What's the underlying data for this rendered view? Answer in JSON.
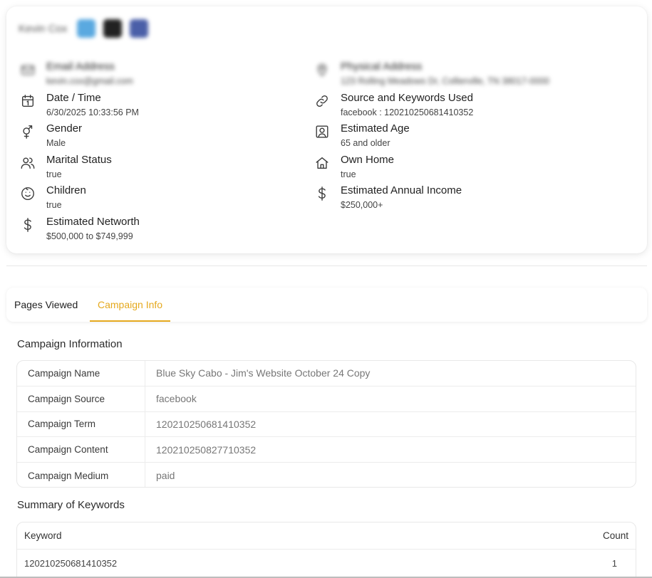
{
  "profile": {
    "name": "Kevin Cox",
    "social_colors": [
      "#5aa9e0",
      "#222222",
      "#4a5fa8"
    ]
  },
  "fields_left": [
    {
      "icon": "email-icon",
      "label": "Email Address",
      "value": "kevin.cox@gmail.com",
      "blurred": true
    },
    {
      "icon": "calendar-icon",
      "label": "Date / Time",
      "value": "6/30/2025 10:33:56 PM"
    },
    {
      "icon": "gender-icon",
      "label": "Gender",
      "value": "Male"
    },
    {
      "icon": "users-icon",
      "label": "Marital Status",
      "value": "true"
    },
    {
      "icon": "smile-icon",
      "label": "Children",
      "value": "true"
    },
    {
      "icon": "dollar-icon",
      "label": "Estimated Networth",
      "value": "$500,000 to $749,999"
    }
  ],
  "fields_right": [
    {
      "icon": "location-icon",
      "label": "Physical Address",
      "value": "123 Rolling Meadows Dr, Collierville, TN 38017-0000",
      "blurred": true
    },
    {
      "icon": "link-icon",
      "label": "Source and Keywords Used",
      "value": "facebook : 120210250681410352"
    },
    {
      "icon": "portrait-icon",
      "label": "Estimated Age",
      "value": "65 and older"
    },
    {
      "icon": "home-icon",
      "label": "Own Home",
      "value": "true"
    },
    {
      "icon": "dollar-icon",
      "label": "Estimated Annual Income",
      "value": "$250,000+"
    }
  ],
  "tabs": {
    "pages_viewed": "Pages Viewed",
    "campaign_info": "Campaign Info",
    "active": "campaign_info",
    "accent": "#e5a91e"
  },
  "campaign": {
    "title": "Campaign Information",
    "rows": [
      {
        "key": "Campaign Name",
        "value": "Blue Sky Cabo - Jim's Website October 24 Copy"
      },
      {
        "key": "Campaign Source",
        "value": "facebook"
      },
      {
        "key": "Campaign Term",
        "value": "120210250681410352"
      },
      {
        "key": "Campaign Content",
        "value": "120210250827710352"
      },
      {
        "key": "Campaign Medium",
        "value": "paid"
      }
    ]
  },
  "keywords": {
    "title": "Summary of Keywords",
    "col_keyword": "Keyword",
    "col_count": "Count",
    "rows": [
      {
        "keyword": "120210250681410352",
        "count": "1"
      }
    ]
  }
}
